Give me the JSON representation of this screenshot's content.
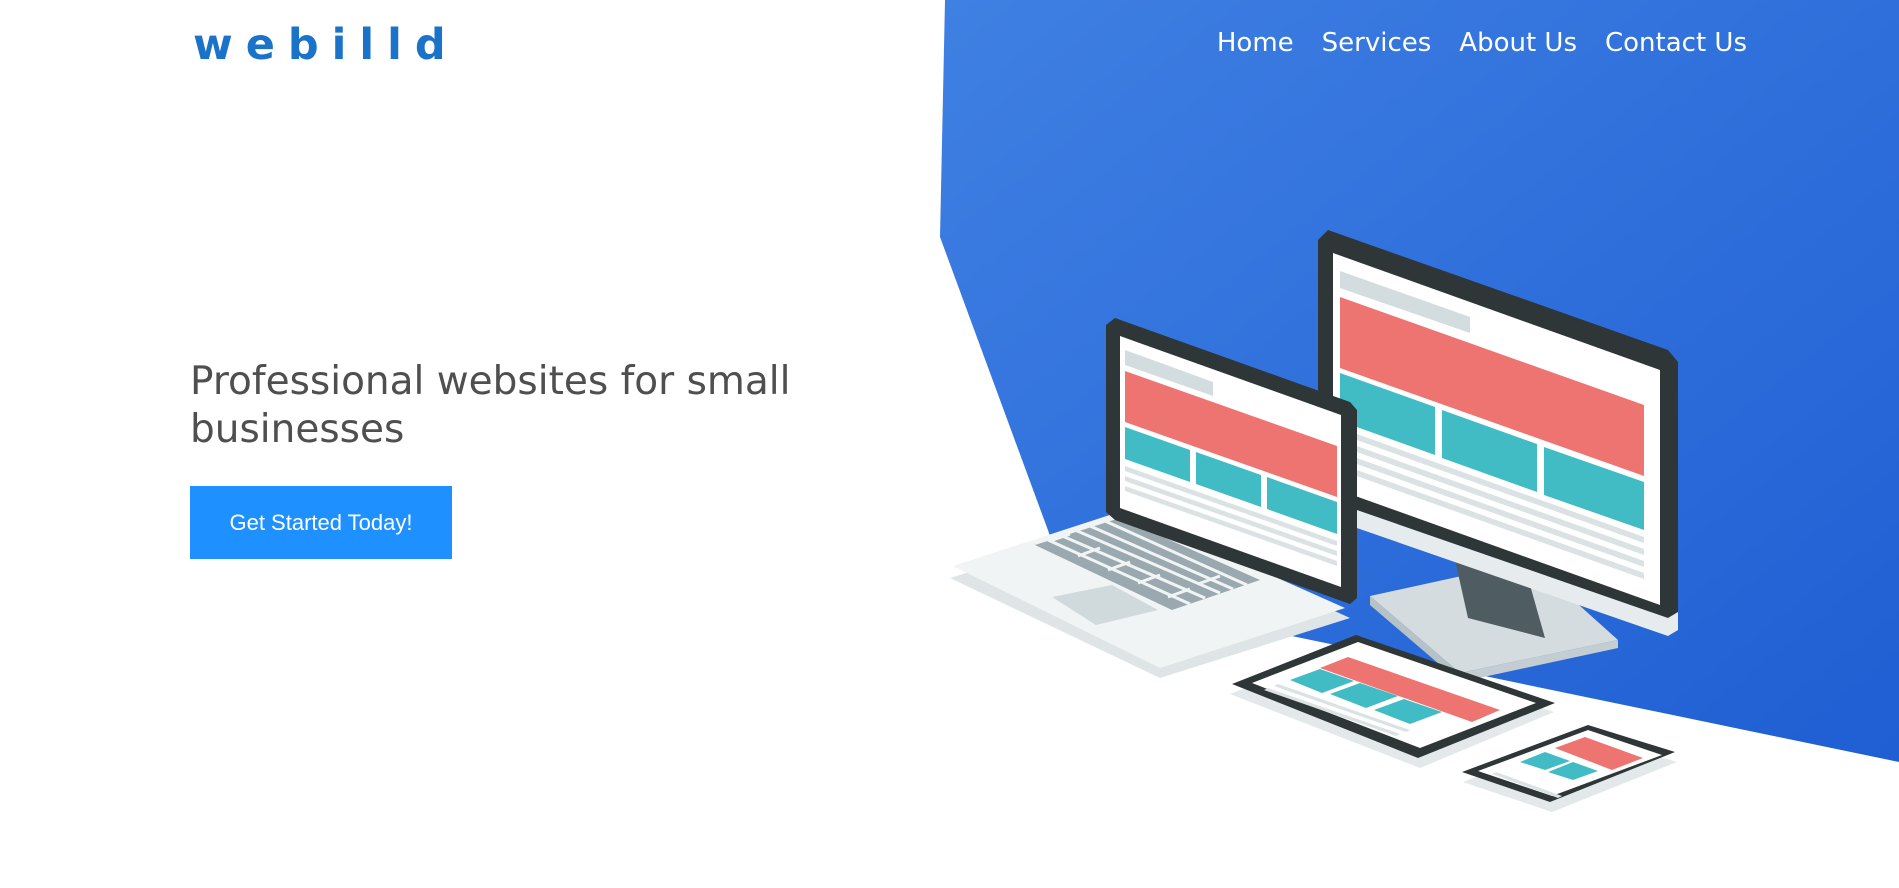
{
  "header": {
    "logo": "webilld",
    "nav": [
      {
        "label": "Home"
      },
      {
        "label": "Services"
      },
      {
        "label": "About Us"
      },
      {
        "label": "Contact Us"
      }
    ]
  },
  "hero": {
    "title": "Professional websites for small businesses",
    "cta_label": "Get Started Today!"
  },
  "colors": {
    "logo": "#1a73c8",
    "cta": "#1e90ff",
    "hero_bg_start": "#3f7fe2",
    "hero_bg_end": "#1f5fd4",
    "title_text": "#4f4f4f",
    "screen_red": "#ee7472",
    "screen_teal": "#42bcc4"
  },
  "illustration": {
    "icon": "responsive-devices-illustration",
    "devices": [
      "desktop-monitor",
      "laptop",
      "tablet",
      "phone"
    ]
  }
}
